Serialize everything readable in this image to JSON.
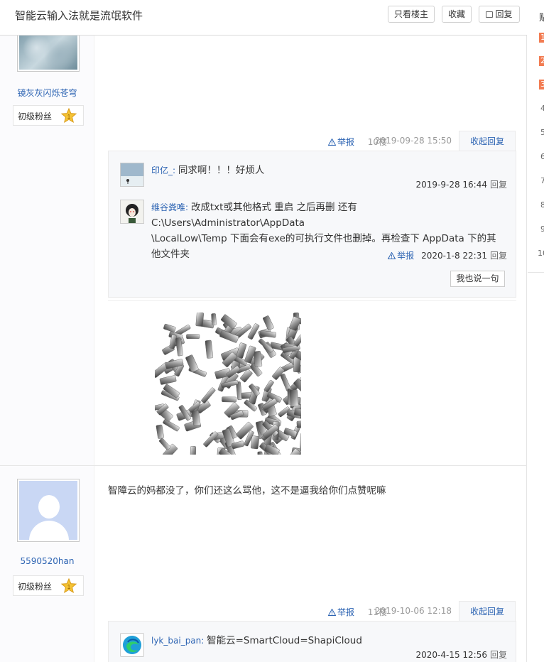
{
  "header": {
    "title": "智能云输入法就是流氓软件",
    "only_op_label": "只看楼主",
    "favorite_label": "收藏",
    "reply_label": "回复"
  },
  "posts": [
    {
      "user": {
        "name": "镜灰灰闪烁苍穹",
        "level_label": "初级粉丝",
        "level": "1"
      },
      "report_label": "举报",
      "floor": "10楼",
      "date": "2019-09-28 15:50",
      "collapse_label": "收起回复",
      "comments": [
        {
          "name": "印亿_",
          "text": "同求啊！！！好烦人",
          "date": "2019-9-28 16:44",
          "reply_label": "回复"
        },
        {
          "name": "维谷粪唯",
          "text_line1": "改成txt或其他格式 重启 之后再删 还有C:\\Users\\Administrator\\AppData",
          "text_line2": "\\LocalLow\\Temp 下面会有exe的可执行文件也删掉。再检查下 AppData 下的其",
          "text_line3": "他文件夹",
          "report_label": "举报",
          "date": "2020-1-8 22:31",
          "reply_label": "回复"
        }
      ],
      "say_label": "我也说一句"
    },
    {
      "user": {
        "name": "5590520han",
        "level_label": "初级粉丝",
        "level": "1"
      },
      "content": "智障云的妈都没了，你们还这么骂他，这不是逼我给你们点赞呢嘛",
      "report_label": "举报",
      "floor": "11楼",
      "date": "2019-10-06 12:18",
      "collapse_label": "收起回复",
      "comments": [
        {
          "name": "lyk_bai_pan",
          "text": "智能云=SmartCloud=ShapiCloud",
          "date": "2020-4-15 12:56",
          "reply_label": "回复"
        }
      ]
    }
  ],
  "right_panel": {
    "title": "贴",
    "ranks": [
      "1",
      "2",
      "3",
      "4",
      "5",
      "6",
      "7",
      "8",
      "9",
      "10"
    ]
  },
  "colors": {
    "link": "#2d64b3",
    "rank_hot": "#f27c52",
    "star": "#f5c334"
  }
}
